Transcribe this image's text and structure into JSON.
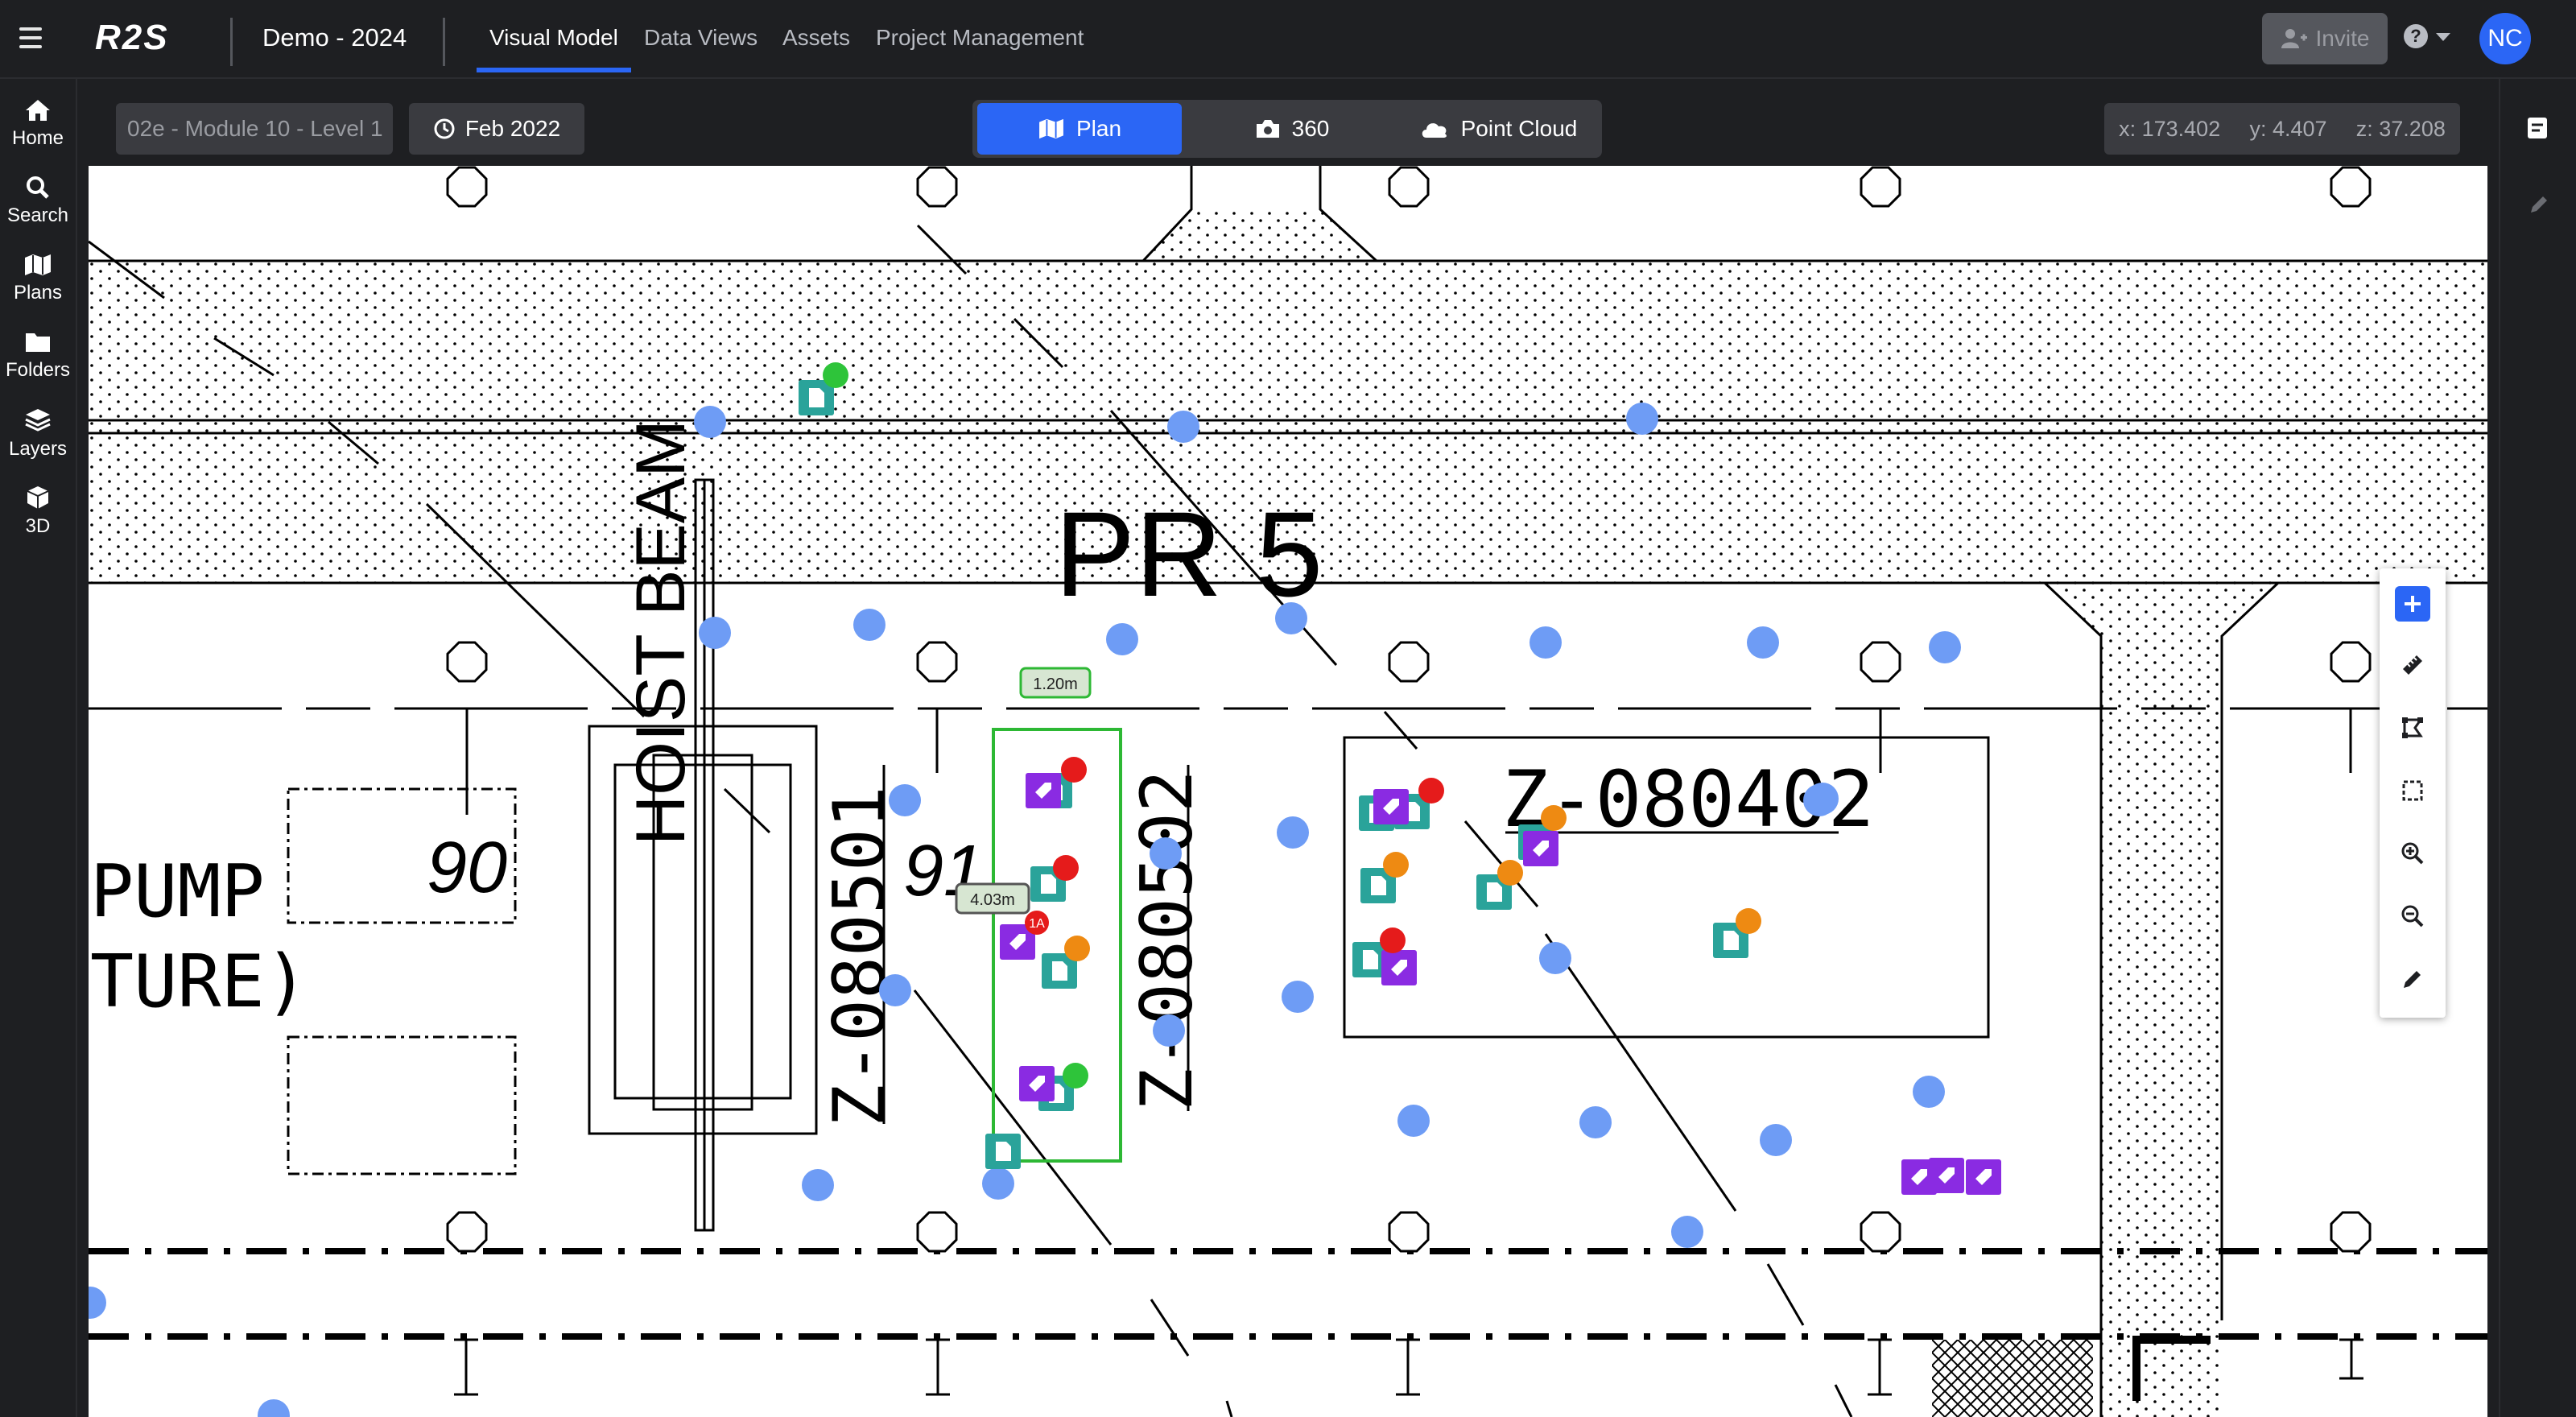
{
  "header": {
    "logo": "R2S",
    "project_title": "Demo - 2024",
    "tabs": [
      {
        "label": "Visual Model",
        "active": true
      },
      {
        "label": "Data Views",
        "active": false
      },
      {
        "label": "Assets",
        "active": false
      },
      {
        "label": "Project Management",
        "active": false
      }
    ],
    "invite_label": "Invite",
    "help_label": "?",
    "avatar_initials": "NC"
  },
  "sidebar": {
    "items": [
      {
        "label": "Home",
        "icon": "home-icon"
      },
      {
        "label": "Search",
        "icon": "search-icon"
      },
      {
        "label": "Plans",
        "icon": "map-icon"
      },
      {
        "label": "Folders",
        "icon": "folder-icon"
      },
      {
        "label": "Layers",
        "icon": "layers-icon"
      },
      {
        "label": "3D",
        "icon": "cube-icon"
      }
    ]
  },
  "toolbar": {
    "level_select": "02e - Module 10 - Level 1",
    "date_select": "Feb 2022",
    "view_modes": [
      {
        "label": "Plan",
        "icon": "map-icon",
        "active": true
      },
      {
        "label": "360",
        "icon": "camera-icon",
        "active": false
      },
      {
        "label": "Point Cloud",
        "icon": "cloud-icon",
        "active": false
      }
    ],
    "coords": {
      "x": "x: 173.402",
      "y": "y: 4.407",
      "z": "z: 37.208"
    }
  },
  "plan": {
    "texts": {
      "pr5": "PR 5",
      "hoist_beam": "HOIST BEAM",
      "z1": "Z-080501",
      "z2": "Z-080502",
      "z3": "Z-080402",
      "n90": "90",
      "n91": "91",
      "pump": "PUMP",
      "ture": "TURE)"
    },
    "measurements": {
      "top": "1.20m",
      "side": "4.03m"
    },
    "marker_badge": "1A"
  },
  "floating_tools": [
    "add-icon",
    "ruler-icon",
    "area-measure-icon",
    "select-area-icon",
    "zoom-in-icon",
    "zoom-out-icon",
    "pencil-icon"
  ],
  "right_panel": [
    "notes-icon",
    "edit-icon"
  ],
  "colors": {
    "accent": "#2b66f5",
    "marker_blue": "#6e9cf5",
    "marker_teal": "#2aa39a",
    "marker_purple": "#8a2be2",
    "marker_red": "#e51b1b",
    "marker_orange": "#ee8a12",
    "marker_green": "#2ec43a",
    "measure_green": "#2db834"
  }
}
